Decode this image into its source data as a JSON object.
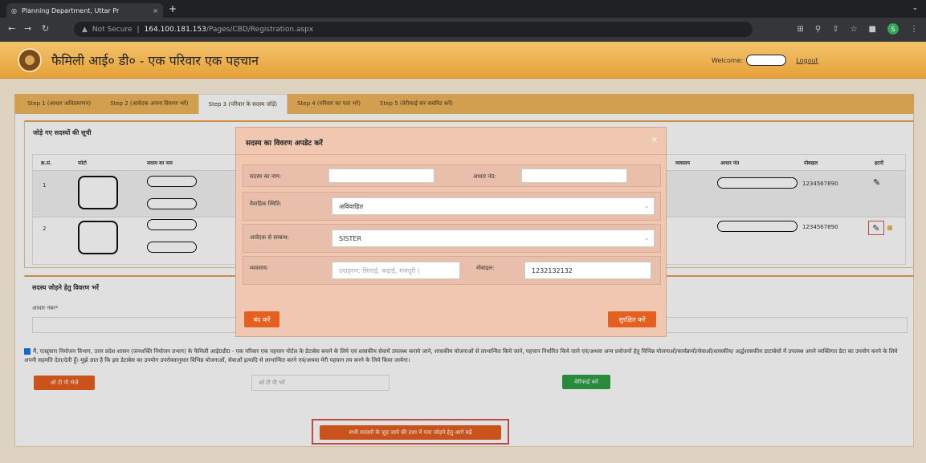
{
  "browser": {
    "tab_title": "Planning Department, Uttar Pr",
    "tab_close": "×",
    "new_tab": "+",
    "security": "Not Secure",
    "url_host": "164.100.181.153",
    "url_path": "/Pages/CBD/Registration.aspx",
    "profile_initial": "S"
  },
  "header": {
    "title": "फैमिली आई० डी० - एक परिवार एक पहचान",
    "welcome_label": "Welcome:",
    "logout_label": "Logout"
  },
  "steps": [
    {
      "label": "Step 1 (आधार अधिप्रमाणन)"
    },
    {
      "label": "Step 2 (आवेदक अपना विवरण भरें)"
    },
    {
      "label": "Step 3 (परिवार के सदस्य जोड़ें)"
    },
    {
      "label": "Step 4 (परिवार का पता भरें)"
    },
    {
      "label": "Step 5 (वेरीफाई कर सबमिट करें)"
    }
  ],
  "members_panel": {
    "title": "जोड़े गए सदस्यों की सूची",
    "columns": {
      "sn": "क्र.सं.",
      "photo": "फोटो",
      "name": "सदस्य का नाम",
      "occupation": "व्यवसाय",
      "aadhaar": "आधार नं0",
      "mobile": "मोबाइल",
      "delete": "हटाएँ"
    },
    "rows": [
      {
        "sn": "1",
        "mobile": "1234567890"
      },
      {
        "sn": "2",
        "mobile": "1234567890"
      }
    ]
  },
  "add_member": {
    "title": "सदस्य जोड़ने हेतु विवरण भरें",
    "aadhaar_label": "आधार नंबर*",
    "consent_text": "मैं, एतद्द्वारा नियोजन विभाग, उत्तर प्रदेश शासन (जनशक्ति नियोजन प्रभाग) के फैमिली आई0डी0 - एक परिवार एक पहचान पोर्टल के डेटाबेस बनाने के लिये एवं शासकीय सेवायें उपलब्ध कराये जाने, शासकीय योजनाओं से लाभान्वित किये जाने, पहचान निर्धारित किये जाने एवं/अथवा अन्य प्रयोजनों हेतु विभिन्न योजनाओं/कार्यक्रमों/सेवाओं/शासकीय/ अर्द्धशासकीय डाटाबेसों में उपलब्ध अपने व्यक्तिगत डेटा का उपयोग करने के लिये अपनी सहमति देता/देती हूँ। मुझे ज्ञात है कि इस डेटाबेस का उपयोग उपरोक्तानुसार विभिन्न योजनाओं, सेवाओं इत्यादि से लाभान्वित करने एवं/अथवा मेरी पहचान तय करने के लिये किया जायेगा।",
    "send_otp": "ओ टी पी भेजें",
    "otp_placeholder": "ओ टी पी भरें",
    "verify": "वेरीफाई करें"
  },
  "proceed_button": "सभी सदस्यों के जुड़ जाने की दशा में पता जोड़ने हेतु आगे बढ़ें",
  "modal": {
    "title": "सदस्य का विवरण अपडेट करें",
    "close_x": "×",
    "name_label": "सदस्य का नाम:",
    "name_value": "",
    "aadhaar_label": "आधार नं0:",
    "aadhaar_value": "",
    "marital_label": "वैवाहिक स्थिति:",
    "marital_value": "अविवाहित",
    "relation_label": "आवेदक से सम्बन्ध:",
    "relation_value": "SISTER",
    "occupation_label": "व्यवसाय:",
    "occupation_placeholder": "उदाहरण: सिलाई, कढ़ाई, मजदूरी (",
    "mobile_label": "मोबाइल:",
    "mobile_value": "1232132132",
    "close_button": "बंद करें",
    "save_button": "सुरक्षित करें"
  },
  "colors": {
    "header": "#e6a13a",
    "button_orange": "#e55f1f",
    "button_green": "#2e9e44",
    "modal_bg": "#f0c8b2"
  }
}
